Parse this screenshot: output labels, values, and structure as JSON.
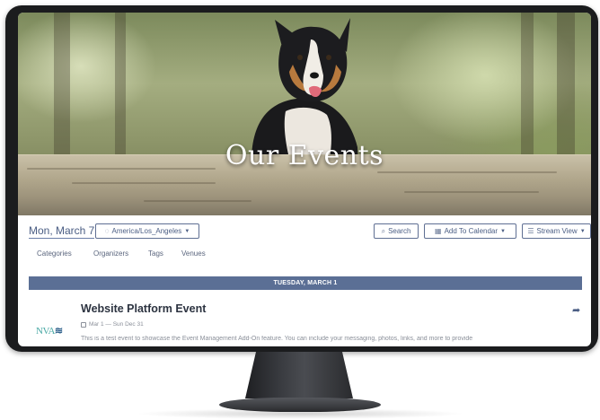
{
  "hero": {
    "title": "Our Events"
  },
  "toolbar": {
    "date": "Mon, March 7",
    "timezone": "America/Los_Angeles",
    "search_label": "Search",
    "add_calendar_label": "Add To Calendar",
    "view_label": "Stream View",
    "icons": {
      "timezone": "globe-icon",
      "search": "search-icon",
      "calendar": "calendar-icon",
      "view": "list-icon"
    }
  },
  "filters": [
    "Categories",
    "Organizers",
    "Tags",
    "Venues"
  ],
  "day_header": "TUESDAY, MARCH 1",
  "event": {
    "logo_text_a": "NVA",
    "logo_text_b": "≋",
    "title": "Website Platform Event",
    "date_range": "Mar 1 — Sun Dec 31",
    "description": "This is a test event to showcase the Event Management Add-On feature. You can include your messaging, photos, links, and more to provide"
  },
  "colors": {
    "accent": "#5b6f95",
    "text": "#2c3340",
    "muted": "#8a8f99",
    "link": "#4b5e84"
  }
}
